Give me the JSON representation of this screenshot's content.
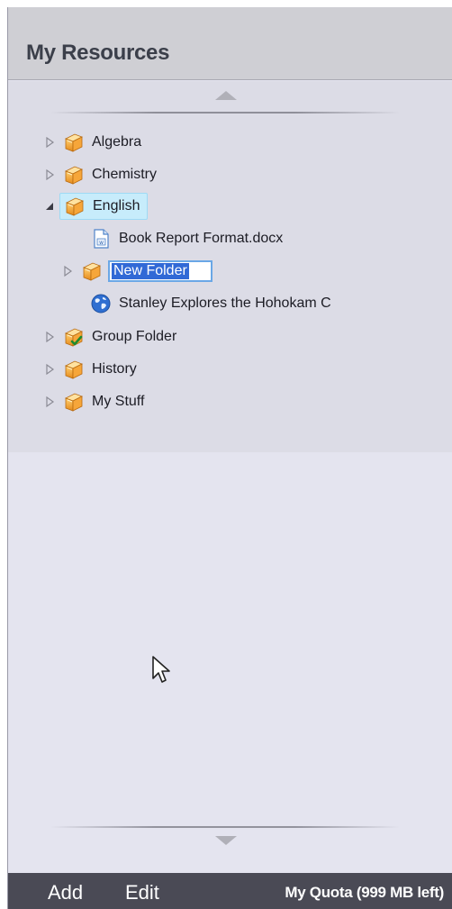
{
  "panel": {
    "title": "My Resources"
  },
  "tree": {
    "items": [
      {
        "label": "Algebra",
        "icon": "folder-icon",
        "expanded": false
      },
      {
        "label": "Chemistry",
        "icon": "folder-icon",
        "expanded": false
      },
      {
        "label": "English",
        "icon": "folder-icon",
        "expanded": true,
        "selected": true,
        "children": [
          {
            "label": "Book Report Format.docx",
            "icon": "word-document-icon"
          },
          {
            "label": "New Folder",
            "icon": "folder-icon",
            "editing": true
          },
          {
            "label": "Stanley Explores the Hohokam C",
            "icon": "globe-icon"
          }
        ]
      },
      {
        "label": "Group Folder",
        "icon": "group-folder-icon",
        "expanded": false
      },
      {
        "label": "History",
        "icon": "folder-icon",
        "expanded": false
      },
      {
        "label": "My Stuff",
        "icon": "folder-icon",
        "expanded": false
      }
    ]
  },
  "footer": {
    "add_label": "Add",
    "edit_label": "Edit",
    "quota_label": "My Quota (999 MB left)"
  },
  "colors": {
    "panel_bg": "#e4e4ef",
    "header_bg": "#cfcfd4",
    "footer_bg": "#4a4a55",
    "selection_bg": "#c7ecfb",
    "edit_highlight": "#3169d6"
  }
}
